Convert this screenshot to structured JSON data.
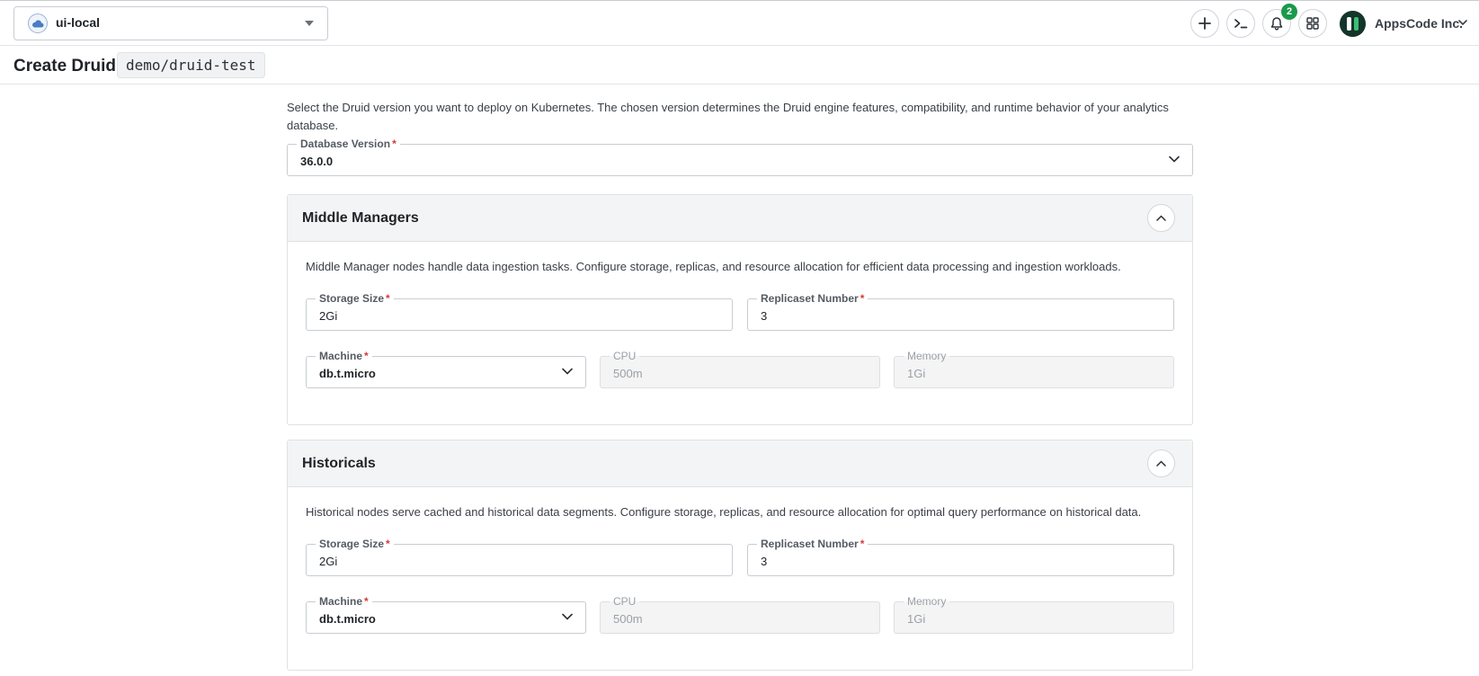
{
  "topbar": {
    "cluster": "ui-local",
    "notifications_count": "2",
    "organization": "AppsCode Inc."
  },
  "page": {
    "title": "Create Druid :",
    "resource_name": "demo/druid-test"
  },
  "intro_text": "Select the Druid version you want to deploy on Kubernetes. The chosen version determines the Druid engine features, compatibility, and runtime behavior of your analytics database.",
  "database_version": {
    "label": "Database Version",
    "value": "36.0.0"
  },
  "required_mark": "*",
  "sections": [
    {
      "title": "Middle Managers",
      "description": "Middle Manager nodes handle data ingestion tasks. Configure storage, replicas, and resource allocation for efficient data processing and ingestion workloads.",
      "storage_size": {
        "label": "Storage Size",
        "value": "2Gi"
      },
      "replicaset": {
        "label": "Replicaset Number",
        "value": "3"
      },
      "machine": {
        "label": "Machine",
        "value": "db.t.micro"
      },
      "cpu": {
        "label": "CPU",
        "value": "500m"
      },
      "memory": {
        "label": "Memory",
        "value": "1Gi"
      }
    },
    {
      "title": "Historicals",
      "description": "Historical nodes serve cached and historical data segments. Configure storage, replicas, and resource allocation for optimal query performance on historical data.",
      "storage_size": {
        "label": "Storage Size",
        "value": "2Gi"
      },
      "replicaset": {
        "label": "Replicaset Number",
        "value": "3"
      },
      "machine": {
        "label": "Machine",
        "value": "db.t.micro"
      },
      "cpu": {
        "label": "CPU",
        "value": "500m"
      },
      "memory": {
        "label": "Memory",
        "value": "1Gi"
      }
    }
  ],
  "icons": {
    "cluster": "cloud-icon",
    "add": "plus-icon",
    "terminal": "terminal-icon",
    "notifications": "bell-icon",
    "apps": "grid-icon",
    "org_caret": "chevron-down-icon",
    "collapse": "chevron-up-icon"
  },
  "colors": {
    "badge": "#1a9a4b",
    "required": "#d43b3b",
    "card_header": "#f3f4f5"
  }
}
